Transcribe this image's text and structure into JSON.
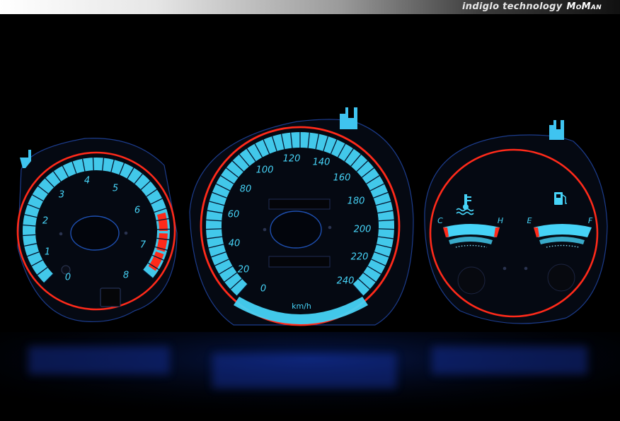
{
  "banner": {
    "text": "indiglo technology",
    "brand": "MoMan"
  },
  "tachometer": {
    "labels": [
      "0",
      "1",
      "2",
      "3",
      "4",
      "5",
      "6",
      "7",
      "8"
    ]
  },
  "speedometer": {
    "labels": [
      "0",
      "20",
      "40",
      "60",
      "80",
      "100",
      "120",
      "140",
      "160",
      "180",
      "200",
      "220",
      "240"
    ],
    "unit": "km/h"
  },
  "temperature_gauge": {
    "low_label": "C",
    "high_label": "H",
    "icon": "coolant-temperature-icon"
  },
  "fuel_gauge": {
    "low_label": "E",
    "high_label": "F",
    "icon": "fuel-pump-icon"
  },
  "colors": {
    "glow": "#46d3f7",
    "glow_dark": "#1a8fd0",
    "redline": "#ff2a1a",
    "background": "#000000"
  }
}
